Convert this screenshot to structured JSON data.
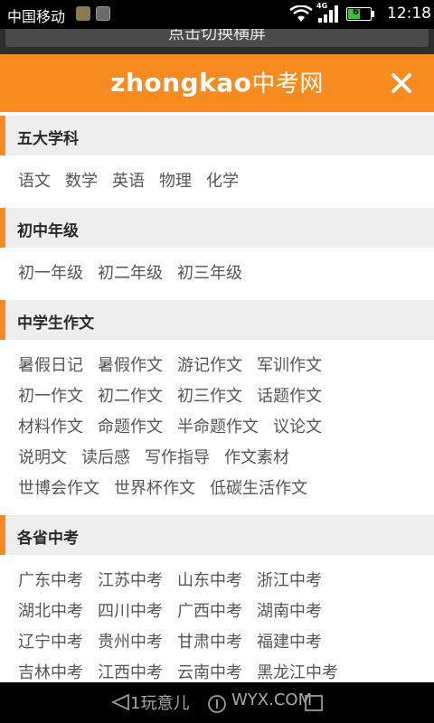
{
  "status_bar": {
    "carrier": "中国移动",
    "network_type": "4G",
    "battery_level": "61",
    "battery_fraction": 0.61,
    "time": "12:18"
  },
  "rotate_banner": {
    "label": "点击切换横屏"
  },
  "header": {
    "logo_en": "zhongkao",
    "logo_cn": "中考网",
    "close_icon": "close-icon",
    "accent_color": "#f78b1f"
  },
  "sections": [
    {
      "title": "五大学科",
      "rows": [
        [
          "语文",
          "数学",
          "英语",
          "物理",
          "化学"
        ]
      ]
    },
    {
      "title": "初中年级",
      "rows": [
        [
          "初一年级",
          "初二年级",
          "初三年级"
        ]
      ]
    },
    {
      "title": "中学生作文",
      "rows": [
        [
          "暑假日记",
          "暑假作文",
          "游记作文",
          "军训作文"
        ],
        [
          "初一作文",
          "初二作文",
          "初三作文",
          "话题作文"
        ],
        [
          "材料作文",
          "命题作文",
          "半命题作文",
          "议论文"
        ],
        [
          "说明文",
          "读后感",
          "写作指导",
          "作文素材"
        ],
        [
          "世博会作文",
          "世界杯作文",
          "低碳生活作文"
        ]
      ]
    },
    {
      "title": "各省中考",
      "rows": [
        [
          "广东中考",
          "江苏中考",
          "山东中考",
          "浙江中考"
        ],
        [
          "湖北中考",
          "四川中考",
          "广西中考",
          "湖南中考"
        ],
        [
          "辽宁中考",
          "贵州中考",
          "甘肃中考",
          "福建中考"
        ],
        [
          "吉林中考",
          "江西中考",
          "云南中考",
          "黑龙江中考"
        ]
      ]
    }
  ],
  "bottom_bar": {
    "watermark_left": "1玩意儿",
    "watermark_right": "WYX.COM"
  }
}
